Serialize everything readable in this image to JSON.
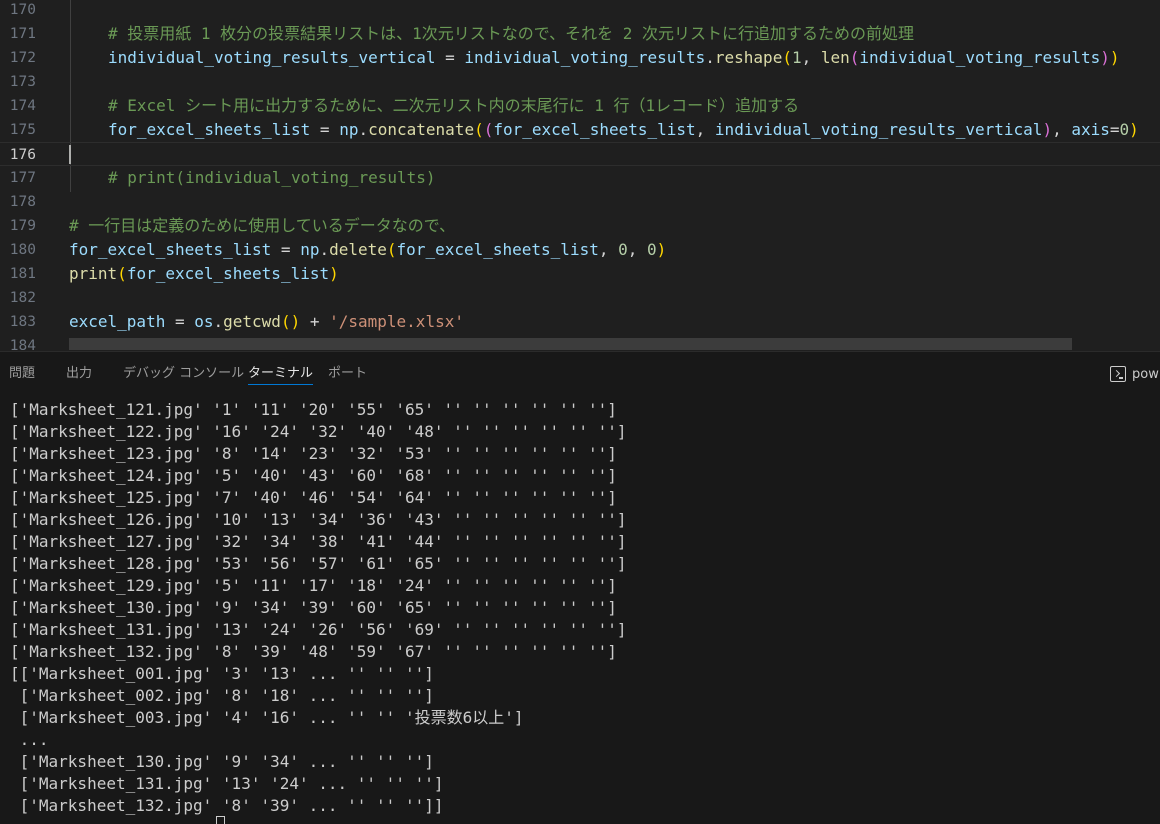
{
  "editor": {
    "lines": [
      {
        "no": "170",
        "segments": []
      },
      {
        "no": "171",
        "segments": [
          {
            "c": "cmt",
            "t": "# 投票用紙 1 枚分の投票結果リストは、1次元リストなので、それを 2 次元リストに行追加するための前処理"
          }
        ]
      },
      {
        "no": "172",
        "segments": [
          {
            "c": "var",
            "t": "individual_voting_results_vertical"
          },
          {
            "c": "op",
            "t": " = "
          },
          {
            "c": "var",
            "t": "individual_voting_results"
          },
          {
            "c": "op",
            "t": "."
          },
          {
            "c": "fn",
            "t": "reshape"
          },
          {
            "c": "b1",
            "t": "("
          },
          {
            "c": "num",
            "t": "1"
          },
          {
            "c": "op",
            "t": ", "
          },
          {
            "c": "fn",
            "t": "len"
          },
          {
            "c": "b2",
            "t": "("
          },
          {
            "c": "var",
            "t": "individual_voting_results"
          },
          {
            "c": "b2",
            "t": ")"
          },
          {
            "c": "b1",
            "t": ")"
          }
        ]
      },
      {
        "no": "173",
        "segments": []
      },
      {
        "no": "174",
        "segments": [
          {
            "c": "cmt",
            "t": "# Excel シート用に出力するために、二次元リスト内の末尾行に 1 行（1レコード）追加する"
          }
        ]
      },
      {
        "no": "175",
        "segments": [
          {
            "c": "var",
            "t": "for_excel_sheets_list"
          },
          {
            "c": "op",
            "t": " = "
          },
          {
            "c": "var",
            "t": "np"
          },
          {
            "c": "op",
            "t": "."
          },
          {
            "c": "fn",
            "t": "concatenate"
          },
          {
            "c": "b1",
            "t": "("
          },
          {
            "c": "b2",
            "t": "("
          },
          {
            "c": "var",
            "t": "for_excel_sheets_list"
          },
          {
            "c": "op",
            "t": ", "
          },
          {
            "c": "var",
            "t": "individual_voting_results_vertical"
          },
          {
            "c": "b2",
            "t": ")"
          },
          {
            "c": "op",
            "t": ", "
          },
          {
            "c": "var",
            "t": "axis"
          },
          {
            "c": "op",
            "t": "="
          },
          {
            "c": "num",
            "t": "0"
          },
          {
            "c": "b1",
            "t": ")"
          }
        ]
      },
      {
        "no": "176",
        "segments": []
      },
      {
        "no": "177",
        "segments": [
          {
            "c": "cmt",
            "t": "# print(individual_voting_results)"
          }
        ]
      },
      {
        "no": "178",
        "segments": []
      },
      {
        "no": "179",
        "segments": [
          {
            "c": "cmt",
            "t": "# 一行目は定義のために使用しているデータなので、"
          }
        ]
      },
      {
        "no": "180",
        "segments": [
          {
            "c": "var",
            "t": "for_excel_sheets_list"
          },
          {
            "c": "op",
            "t": " = "
          },
          {
            "c": "var",
            "t": "np"
          },
          {
            "c": "op",
            "t": "."
          },
          {
            "c": "fn",
            "t": "delete"
          },
          {
            "c": "b1",
            "t": "("
          },
          {
            "c": "var",
            "t": "for_excel_sheets_list"
          },
          {
            "c": "op",
            "t": ", "
          },
          {
            "c": "num",
            "t": "0"
          },
          {
            "c": "op",
            "t": ", "
          },
          {
            "c": "num",
            "t": "0"
          },
          {
            "c": "b1",
            "t": ")"
          }
        ]
      },
      {
        "no": "181",
        "segments": [
          {
            "c": "fn",
            "t": "print"
          },
          {
            "c": "b1",
            "t": "("
          },
          {
            "c": "var",
            "t": "for_excel_sheets_list"
          },
          {
            "c": "b1",
            "t": ")"
          }
        ]
      },
      {
        "no": "182",
        "segments": []
      },
      {
        "no": "183",
        "segments": [
          {
            "c": "var",
            "t": "excel_path"
          },
          {
            "c": "op",
            "t": " = "
          },
          {
            "c": "var",
            "t": "os"
          },
          {
            "c": "op",
            "t": "."
          },
          {
            "c": "fn",
            "t": "getcwd"
          },
          {
            "c": "b1",
            "t": "()"
          },
          {
            "c": "op",
            "t": " + "
          },
          {
            "c": "str",
            "t": "'/sample.xlsx'"
          }
        ]
      },
      {
        "no": "184",
        "segments": []
      }
    ],
    "active_line": "176"
  },
  "panel": {
    "tabs": [
      "問題",
      "出力",
      "デバッグ コンソール",
      "ターミナル",
      "ポート"
    ],
    "active_tab": "ターミナル",
    "terminal_button_label": "pow"
  },
  "terminal": {
    "lines": [
      "['Marksheet_121.jpg' '1' '11' '20' '55' '65' '' '' '' '' '' '']",
      "['Marksheet_122.jpg' '16' '24' '32' '40' '48' '' '' '' '' '' '']",
      "['Marksheet_123.jpg' '8' '14' '23' '32' '53' '' '' '' '' '' '']",
      "['Marksheet_124.jpg' '5' '40' '43' '60' '68' '' '' '' '' '' '']",
      "['Marksheet_125.jpg' '7' '40' '46' '54' '64' '' '' '' '' '' '']",
      "['Marksheet_126.jpg' '10' '13' '34' '36' '43' '' '' '' '' '' '']",
      "['Marksheet_127.jpg' '32' '34' '38' '41' '44' '' '' '' '' '' '']",
      "['Marksheet_128.jpg' '53' '56' '57' '61' '65' '' '' '' '' '' '']",
      "['Marksheet_129.jpg' '5' '11' '17' '18' '24' '' '' '' '' '' '']",
      "['Marksheet_130.jpg' '9' '34' '39' '60' '65' '' '' '' '' '' '']",
      "['Marksheet_131.jpg' '13' '24' '26' '56' '69' '' '' '' '' '' '']",
      "['Marksheet_132.jpg' '8' '39' '48' '59' '67' '' '' '' '' '' '']",
      "[['Marksheet_001.jpg' '3' '13' ... '' '' '']",
      " ['Marksheet_002.jpg' '8' '18' ... '' '' '']",
      " ['Marksheet_003.jpg' '4' '16' ... '' '' '投票数6以上']",
      " ...",
      " ['Marksheet_130.jpg' '9' '34' ... '' '' '']",
      " ['Marksheet_131.jpg' '13' '24' ... '' '' '']",
      " ['Marksheet_132.jpg' '8' '39' ... '' '' '']]"
    ]
  }
}
